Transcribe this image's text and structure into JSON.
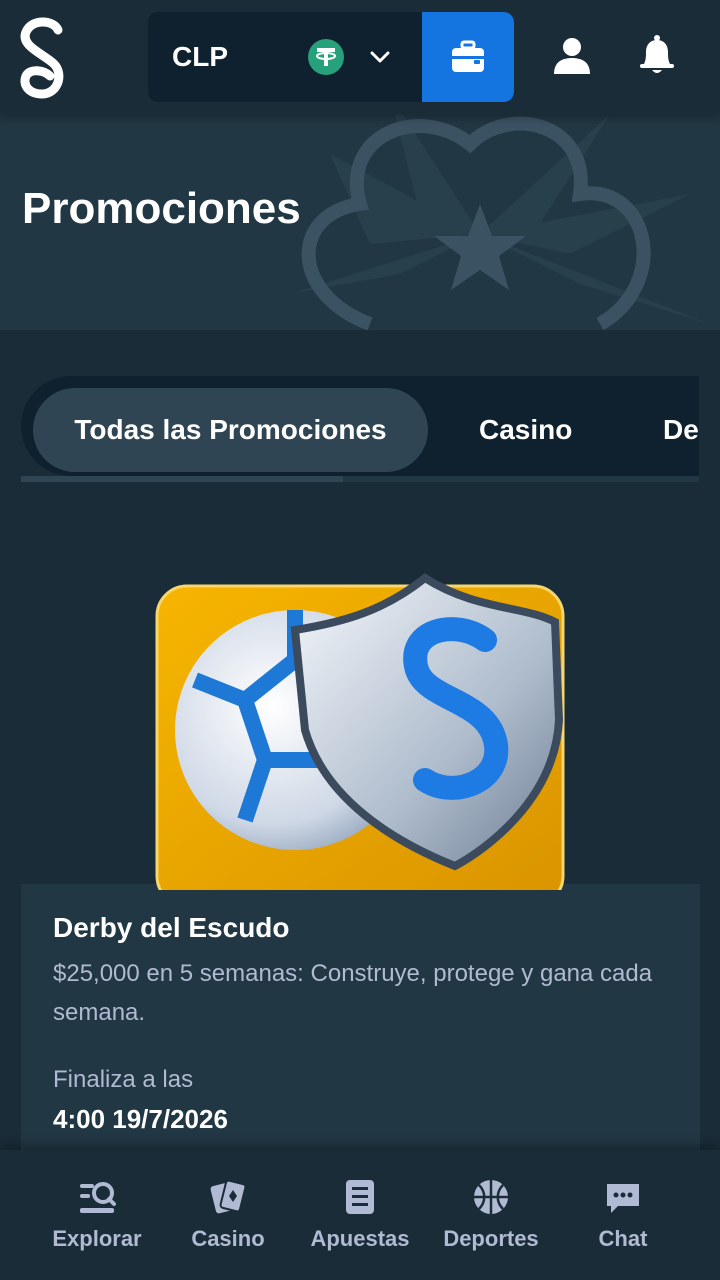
{
  "header": {
    "currency": "CLP",
    "currency_icon": "tether-icon",
    "colors": {
      "wallet_button": "#1475e1",
      "tether": "#26a17b"
    }
  },
  "hero": {
    "title": "Promociones"
  },
  "tabs": [
    {
      "label": "Todas las Promociones",
      "active": true
    },
    {
      "label": "Casino",
      "active": false
    },
    {
      "label": "De",
      "active": false
    }
  ],
  "promo": {
    "title": "Derby del Escudo",
    "description": "$25,000 en 5 semanas: Construye, protege y gana cada semana.",
    "ends_label": "Finaliza a las",
    "ends_date": "4:00 19/7/2026"
  },
  "bottom_nav": [
    {
      "label": "Explorar",
      "icon": "explore-icon"
    },
    {
      "label": "Casino",
      "icon": "cards-icon"
    },
    {
      "label": "Apuestas",
      "icon": "betslip-icon"
    },
    {
      "label": "Deportes",
      "icon": "basketball-icon"
    },
    {
      "label": "Chat",
      "icon": "chat-icon"
    }
  ]
}
